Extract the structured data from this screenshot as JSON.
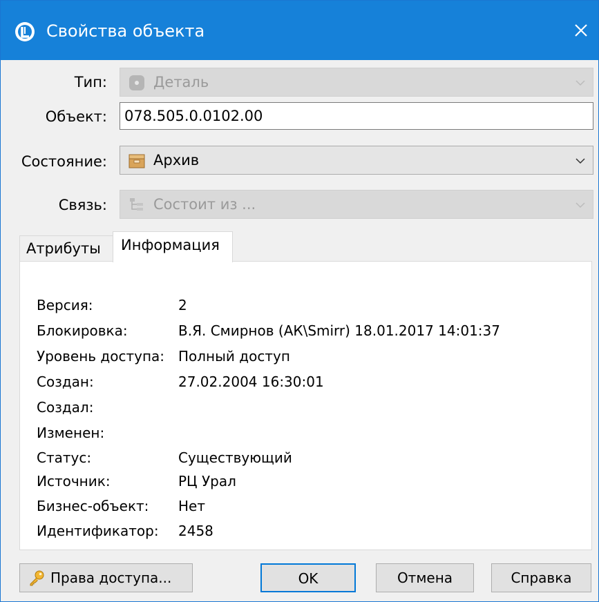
{
  "window": {
    "title": "Свойства объекта",
    "title_icon": "app-logo-icon",
    "accent": "#1681d9"
  },
  "fields": {
    "type": {
      "label": "Тип:",
      "value": "Деталь",
      "icon": "part-icon",
      "disabled": true
    },
    "object": {
      "label": "Объект:",
      "value": "078.505.0.0102.00"
    },
    "state": {
      "label": "Состояние:",
      "value": "Архив",
      "icon": "archive-box-icon",
      "disabled": false
    },
    "link": {
      "label": "Связь:",
      "value": "Состоит из ...",
      "icon": "tree-structure-icon",
      "disabled": true
    }
  },
  "tabs": [
    {
      "label": "Атрибуты",
      "active": false
    },
    {
      "label": "Информация",
      "active": true
    }
  ],
  "info": [
    {
      "key": "Версия:",
      "value": "2"
    },
    {
      "key": "Блокировка:",
      "value": "В.Я. Смирнов (АК\\Smirr) 18.01.2017 14:01:37"
    },
    {
      "key": "Уровень доступа:",
      "value": "Полный доступ"
    },
    {
      "key": "Создан:",
      "value": "27.02.2004 16:30:01"
    },
    {
      "key": "Создал:",
      "value": ""
    },
    {
      "key": "Изменен:",
      "value": ""
    },
    {
      "key": "Статус:",
      "value": "Существующий"
    },
    {
      "key": "Источник:",
      "value": "РЦ Урал"
    },
    {
      "key": "Бизнес-объект:",
      "value": "Нет"
    },
    {
      "key": "Идентификатор:",
      "value": "2458"
    }
  ],
  "buttons": {
    "access": "Права доступа...",
    "ok": "OK",
    "cancel": "Отмена",
    "help": "Справка"
  }
}
